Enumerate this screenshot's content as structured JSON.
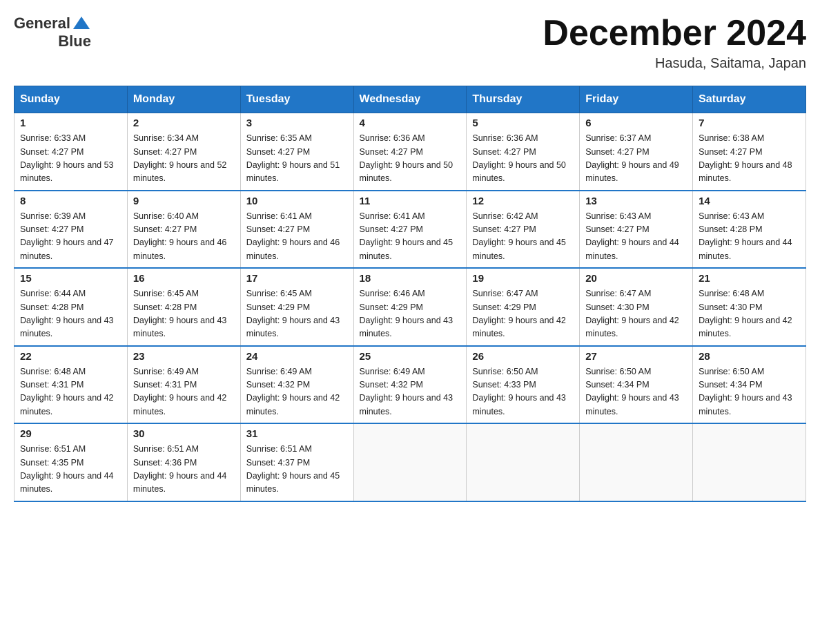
{
  "header": {
    "logo_general": "General",
    "logo_blue": "Blue",
    "month_title": "December 2024",
    "location": "Hasuda, Saitama, Japan"
  },
  "weekdays": [
    "Sunday",
    "Monday",
    "Tuesday",
    "Wednesday",
    "Thursday",
    "Friday",
    "Saturday"
  ],
  "weeks": [
    [
      {
        "day": "1",
        "sunrise": "6:33 AM",
        "sunset": "4:27 PM",
        "daylight": "9 hours and 53 minutes."
      },
      {
        "day": "2",
        "sunrise": "6:34 AM",
        "sunset": "4:27 PM",
        "daylight": "9 hours and 52 minutes."
      },
      {
        "day": "3",
        "sunrise": "6:35 AM",
        "sunset": "4:27 PM",
        "daylight": "9 hours and 51 minutes."
      },
      {
        "day": "4",
        "sunrise": "6:36 AM",
        "sunset": "4:27 PM",
        "daylight": "9 hours and 50 minutes."
      },
      {
        "day": "5",
        "sunrise": "6:36 AM",
        "sunset": "4:27 PM",
        "daylight": "9 hours and 50 minutes."
      },
      {
        "day": "6",
        "sunrise": "6:37 AM",
        "sunset": "4:27 PM",
        "daylight": "9 hours and 49 minutes."
      },
      {
        "day": "7",
        "sunrise": "6:38 AM",
        "sunset": "4:27 PM",
        "daylight": "9 hours and 48 minutes."
      }
    ],
    [
      {
        "day": "8",
        "sunrise": "6:39 AM",
        "sunset": "4:27 PM",
        "daylight": "9 hours and 47 minutes."
      },
      {
        "day": "9",
        "sunrise": "6:40 AM",
        "sunset": "4:27 PM",
        "daylight": "9 hours and 46 minutes."
      },
      {
        "day": "10",
        "sunrise": "6:41 AM",
        "sunset": "4:27 PM",
        "daylight": "9 hours and 46 minutes."
      },
      {
        "day": "11",
        "sunrise": "6:41 AM",
        "sunset": "4:27 PM",
        "daylight": "9 hours and 45 minutes."
      },
      {
        "day": "12",
        "sunrise": "6:42 AM",
        "sunset": "4:27 PM",
        "daylight": "9 hours and 45 minutes."
      },
      {
        "day": "13",
        "sunrise": "6:43 AM",
        "sunset": "4:27 PM",
        "daylight": "9 hours and 44 minutes."
      },
      {
        "day": "14",
        "sunrise": "6:43 AM",
        "sunset": "4:28 PM",
        "daylight": "9 hours and 44 minutes."
      }
    ],
    [
      {
        "day": "15",
        "sunrise": "6:44 AM",
        "sunset": "4:28 PM",
        "daylight": "9 hours and 43 minutes."
      },
      {
        "day": "16",
        "sunrise": "6:45 AM",
        "sunset": "4:28 PM",
        "daylight": "9 hours and 43 minutes."
      },
      {
        "day": "17",
        "sunrise": "6:45 AM",
        "sunset": "4:29 PM",
        "daylight": "9 hours and 43 minutes."
      },
      {
        "day": "18",
        "sunrise": "6:46 AM",
        "sunset": "4:29 PM",
        "daylight": "9 hours and 43 minutes."
      },
      {
        "day": "19",
        "sunrise": "6:47 AM",
        "sunset": "4:29 PM",
        "daylight": "9 hours and 42 minutes."
      },
      {
        "day": "20",
        "sunrise": "6:47 AM",
        "sunset": "4:30 PM",
        "daylight": "9 hours and 42 minutes."
      },
      {
        "day": "21",
        "sunrise": "6:48 AM",
        "sunset": "4:30 PM",
        "daylight": "9 hours and 42 minutes."
      }
    ],
    [
      {
        "day": "22",
        "sunrise": "6:48 AM",
        "sunset": "4:31 PM",
        "daylight": "9 hours and 42 minutes."
      },
      {
        "day": "23",
        "sunrise": "6:49 AM",
        "sunset": "4:31 PM",
        "daylight": "9 hours and 42 minutes."
      },
      {
        "day": "24",
        "sunrise": "6:49 AM",
        "sunset": "4:32 PM",
        "daylight": "9 hours and 42 minutes."
      },
      {
        "day": "25",
        "sunrise": "6:49 AM",
        "sunset": "4:32 PM",
        "daylight": "9 hours and 43 minutes."
      },
      {
        "day": "26",
        "sunrise": "6:50 AM",
        "sunset": "4:33 PM",
        "daylight": "9 hours and 43 minutes."
      },
      {
        "day": "27",
        "sunrise": "6:50 AM",
        "sunset": "4:34 PM",
        "daylight": "9 hours and 43 minutes."
      },
      {
        "day": "28",
        "sunrise": "6:50 AM",
        "sunset": "4:34 PM",
        "daylight": "9 hours and 43 minutes."
      }
    ],
    [
      {
        "day": "29",
        "sunrise": "6:51 AM",
        "sunset": "4:35 PM",
        "daylight": "9 hours and 44 minutes."
      },
      {
        "day": "30",
        "sunrise": "6:51 AM",
        "sunset": "4:36 PM",
        "daylight": "9 hours and 44 minutes."
      },
      {
        "day": "31",
        "sunrise": "6:51 AM",
        "sunset": "4:37 PM",
        "daylight": "9 hours and 45 minutes."
      },
      null,
      null,
      null,
      null
    ]
  ]
}
